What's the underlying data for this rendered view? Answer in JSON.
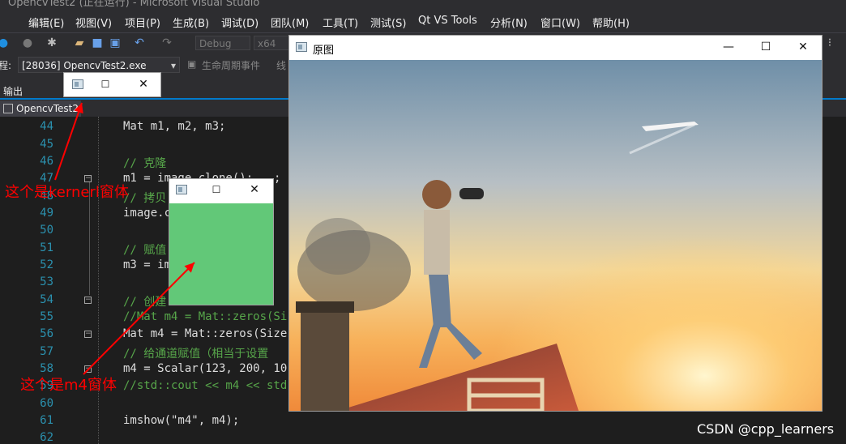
{
  "window_title": "OpencvTest2 (正在运行) - Microsoft Visual Studio",
  "menu": [
    "编辑(E)",
    "视图(V)",
    "项目(P)",
    "生成(B)",
    "调试(D)",
    "团队(M)",
    "工具(T)",
    "测试(S)",
    "Qt VS Tools",
    "分析(N)",
    "窗口(W)",
    "帮助(H)"
  ],
  "toolbar": {
    "config": "Debug",
    "platform": "x64"
  },
  "process_bar": {
    "label": "程:",
    "process": "[28036] OpencvTest2.exe",
    "lifecycle": "生命周期事件",
    "thread": "线"
  },
  "output_tab": "输出",
  "doc_tab": "OpencvTest2",
  "code_lines": [
    {
      "n": "44",
      "code": "Mat m1, m2, m3;"
    },
    {
      "n": "45",
      "code": ""
    },
    {
      "n": "46",
      "code": "// 克隆"
    },
    {
      "n": "47",
      "code": "m1 = image.clone();"
    },
    {
      "n": "48",
      "code": "// 拷贝"
    },
    {
      "n": "49",
      "code": "image.c"
    },
    {
      "n": "50",
      "code": ""
    },
    {
      "n": "51",
      "code": "// 赋值"
    },
    {
      "n": "52",
      "code": "m3 = im"
    },
    {
      "n": "53",
      "code": ""
    },
    {
      "n": "54",
      "code": "// 创建"
    },
    {
      "n": "55",
      "code": "//Mat m4 = Mat::zeros(Si"
    },
    {
      "n": "56",
      "code": "Mat m4 = Mat::zeros(Size"
    },
    {
      "n": "57",
      "code": "// 给通道赋值（相当于设置"
    },
    {
      "n": "58",
      "code": "m4 = Scalar(123, 200, 10"
    },
    {
      "n": "59",
      "code": "//std::cout << m4 << std"
    },
    {
      "n": "60",
      "code": ""
    },
    {
      "n": "61",
      "code": "imshow(\"m4\", m4);"
    },
    {
      "n": "62",
      "code": ""
    }
  ],
  "original_window": {
    "title": "原图"
  },
  "annotations": {
    "kernel": "这个是kernerl窗体",
    "m4": "这个是m4窗体"
  },
  "watermark": "CSDN @cpp_learners",
  "colors": {
    "m4_fill": "#62c878",
    "annotation": "#ff0000",
    "accent": "#007acc"
  },
  "icons": [
    "window-icon",
    "minimize-icon",
    "maximize-icon",
    "close-icon"
  ]
}
